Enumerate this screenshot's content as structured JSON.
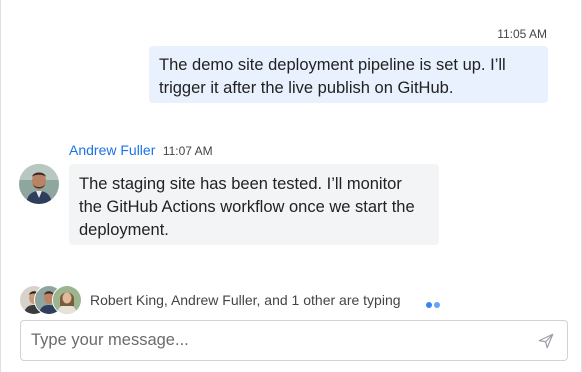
{
  "colors": {
    "outgoing_bubble": "#e8f1fd",
    "incoming_bubble": "#f3f4f6",
    "author_name": "#1a73e8",
    "typing_dot": "#3b82f6"
  },
  "messages": {
    "outgoing": {
      "time": "11:05 AM",
      "text": "The demo site deployment pipeline is set up. I’ll trigger it after the live publish on GitHub."
    },
    "incoming": {
      "author": "Andrew Fuller",
      "time": "11:07 AM",
      "text": "The staging site has been tested. I’ll monitor the GitHub Actions workflow once we start the deployment."
    }
  },
  "typing": {
    "text": "Robert King, Andrew Fuller, and 1 other are typing"
  },
  "composer": {
    "placeholder": "Type your message...",
    "value": "",
    "send_icon": "send-icon"
  }
}
